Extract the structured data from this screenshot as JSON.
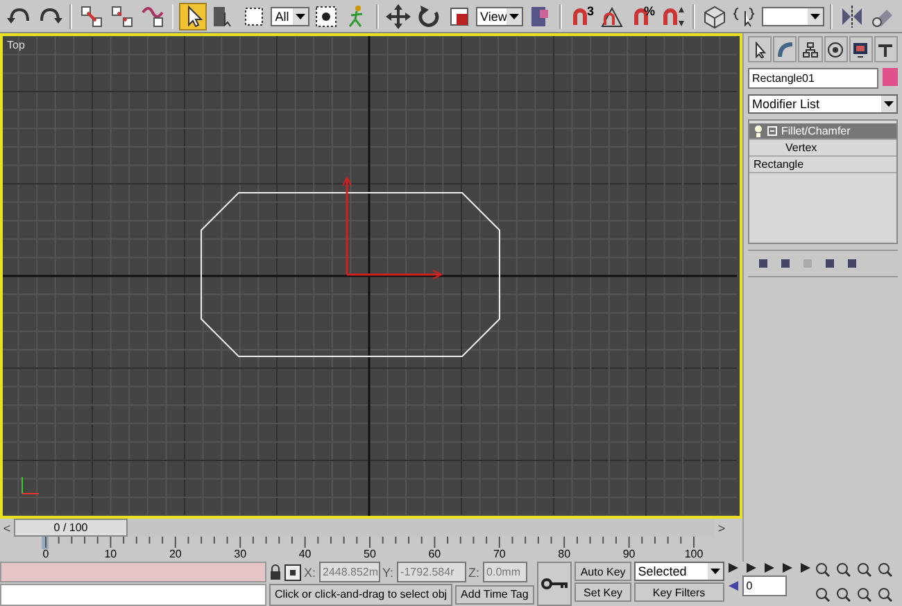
{
  "toolbar": {
    "tools": [
      {
        "kind": "undo",
        "selected": false
      },
      {
        "kind": "redo",
        "selected": false
      },
      {
        "kind": "sep"
      },
      {
        "kind": "link",
        "selected": false
      },
      {
        "kind": "unlink",
        "selected": false
      },
      {
        "kind": "bind",
        "selected": false
      },
      {
        "kind": "sep"
      },
      {
        "kind": "select",
        "selected": true
      },
      {
        "kind": "list",
        "selected": false
      },
      {
        "kind": "region",
        "selected": false
      },
      {
        "kind": "dropdown",
        "value": "All"
      },
      {
        "kind": "crossing",
        "selected": false
      },
      {
        "kind": "figure",
        "selected": false
      },
      {
        "kind": "sep"
      },
      {
        "kind": "move",
        "selected": false
      },
      {
        "kind": "rotate",
        "selected": false
      },
      {
        "kind": "scale",
        "selected": false
      },
      {
        "kind": "dropdown",
        "value": "View"
      },
      {
        "kind": "pivot",
        "selected": false
      },
      {
        "kind": "sep"
      },
      {
        "kind": "snap",
        "selected": false,
        "label": "3"
      },
      {
        "kind": "angle",
        "selected": false
      },
      {
        "kind": "snap",
        "selected": false,
        "label": "%"
      },
      {
        "kind": "spinner",
        "selected": false
      },
      {
        "kind": "sep"
      },
      {
        "kind": "box",
        "selected": false
      },
      {
        "kind": "named",
        "selected": false
      },
      {
        "kind": "dropdown"
      },
      {
        "kind": "sep"
      },
      {
        "kind": "mirror",
        "selected": false
      },
      {
        "kind": "align",
        "selected": false
      }
    ]
  },
  "viewport": {
    "label": "Top"
  },
  "command_panel": {
    "object_name": "Rectangle01",
    "modifier_list": "Modifier List",
    "stack": [
      {
        "label": "Fillet/Chamfer",
        "selected": true,
        "children": [
          {
            "label": "Vertex",
            "selected": false
          }
        ]
      },
      {
        "label": "Rectangle",
        "selected": false
      }
    ]
  },
  "time_slider": {
    "prev": "<",
    "label": "0 / 100",
    "level": 0,
    "next": ">"
  },
  "ruler": {
    "ticks": [
      "0",
      "10",
      "20",
      "30",
      "40",
      "50",
      "60",
      "70",
      "80",
      "90",
      "100"
    ]
  },
  "status_bar": {
    "x_label": "X:",
    "x": "2448.852m",
    "y_label": "Y:",
    "y": "-1792.584r",
    "z_label": "Z:",
    "z": "0.0mm",
    "prompt": "Click or click-and-drag to select obj",
    "add_time_tag": "Add Time Tag",
    "auto_key": "Auto Key",
    "set_key": "Set Key",
    "key_mode": "Selected",
    "key_filters": "Key Filters",
    "frame": "0"
  }
}
